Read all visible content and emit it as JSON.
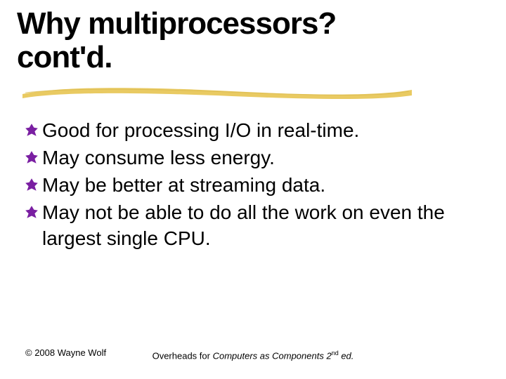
{
  "title_line1": "Why multiprocessors?",
  "title_line2": "cont'd.",
  "bullets": [
    "Good for processing I/O in real-time.",
    "May consume less energy.",
    "May be better at streaming data.",
    "May not be able to do all the work on even the largest single CPU."
  ],
  "footer": {
    "left": "© 2008 Wayne Wolf",
    "center_line1": "Overheads for ",
    "center_italic": "Computers as Components 2",
    "center_sup": "nd",
    "center_tail": " ed."
  },
  "colors": {
    "yellow": "#e8c75a",
    "purple": "#7a1fa2"
  }
}
